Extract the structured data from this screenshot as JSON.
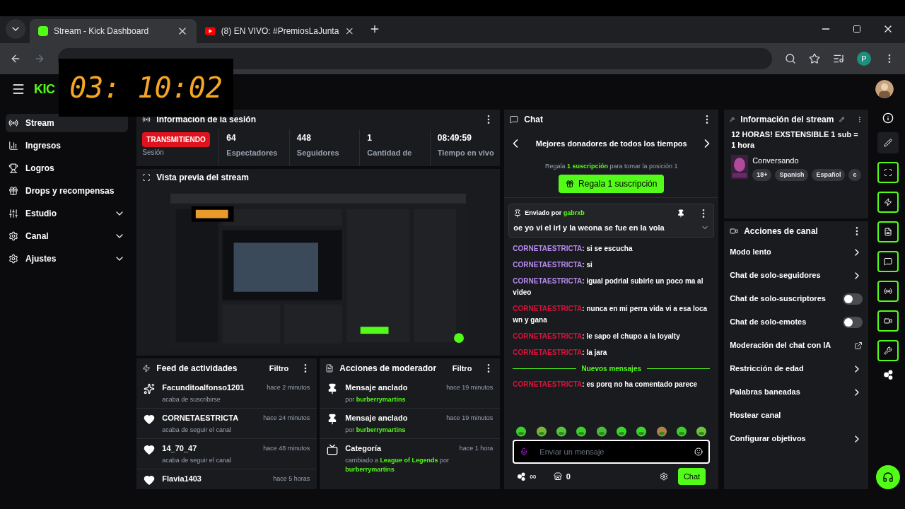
{
  "browser": {
    "tabs": [
      {
        "title": "Stream - Kick Dashboard",
        "selected": true,
        "kind": "kick"
      },
      {
        "title": "(8) EN VIVO: #PremiosLaJunta",
        "selected": false,
        "kind": "youtube"
      }
    ],
    "profile": "P"
  },
  "timer": "03: 10:02",
  "header": {
    "logo": "KIC"
  },
  "sidebar": {
    "items": [
      {
        "label": "Stream",
        "selected": true,
        "submenu": false
      },
      {
        "label": "Ingresos",
        "selected": false,
        "submenu": false
      },
      {
        "label": "Logros",
        "selected": false,
        "submenu": false
      },
      {
        "label": "Drops y recompensas",
        "selected": false,
        "submenu": false
      },
      {
        "label": "Estudio",
        "selected": false,
        "submenu": true
      },
      {
        "label": "Canal",
        "selected": false,
        "submenu": true
      },
      {
        "label": "Ajustes",
        "selected": false,
        "submenu": true
      }
    ]
  },
  "session": {
    "title": "Información de la sesión",
    "status": "TRANSMITIENDO",
    "status_label": "Sesión",
    "stats": [
      {
        "value": "64",
        "label": "Espectadores"
      },
      {
        "value": "448",
        "label": "Seguidores"
      },
      {
        "value": "1",
        "label": "Cantidad de"
      },
      {
        "value": "08:49:59",
        "label": "Tiempo en vivo"
      }
    ]
  },
  "preview": {
    "title": "Vista previa del stream",
    "kind": "picture"
  },
  "activity": {
    "title": "Feed de actividades",
    "filter": "Filtro",
    "items": [
      {
        "kind": "subscribe",
        "name": "Facunditoalfonso1201",
        "desc": "acaba de suscribirse",
        "time": "hace 2 minutos"
      },
      {
        "kind": "follow",
        "name": "CORNETAESTRICTA",
        "desc": "acaba de seguir el canal",
        "time": "hace 24 minutos"
      },
      {
        "kind": "follow",
        "name": "14_70_47",
        "desc": "acaba de seguir el canal",
        "time": "hace 48 minutos"
      },
      {
        "kind": "follow",
        "name": "Flavia1403",
        "time": "hace 5 horas"
      }
    ]
  },
  "moderator": {
    "title": "Acciones de moderador",
    "filter": "Filtro",
    "items": [
      {
        "kind": "pin",
        "name": "Mensaje anclado",
        "time": "hace 19 minutos",
        "desc": [
          {
            "text": "por ",
            "highlight": false
          },
          {
            "text": "burberrymartins",
            "highlight": true
          }
        ]
      },
      {
        "kind": "pin",
        "name": "Mensaje anclado",
        "time": "hace 19 minutos",
        "desc": [
          {
            "text": "por ",
            "highlight": false
          },
          {
            "text": "burberrymartins",
            "highlight": true
          }
        ]
      },
      {
        "kind": "category",
        "name": "Categoría",
        "time": "hace 1 hora",
        "desc": [
          {
            "text": "cambiado a ",
            "highlight": false
          },
          {
            "text": "League of Legends",
            "highlight": true
          },
          {
            "text": " por ",
            "highlight": false
          },
          {
            "text": "burberrymartins",
            "highlight": true
          }
        ]
      }
    ]
  },
  "chat": {
    "title": "Chat",
    "leaderboard": "Mejores donadores de todos los tiempos",
    "gift_line": [
      {
        "text": "Regala ",
        "highlight": false
      },
      {
        "text": "1 suscripción",
        "highlight": true
      },
      {
        "text": " para tomar la posición 1",
        "highlight": false
      }
    ],
    "gift_button": "Regala 1 suscripción",
    "pinned": {
      "by": [
        {
          "text": "Enviado por ",
          "highlight": false
        },
        {
          "text": "gabrxb",
          "highlight": true
        }
      ],
      "text": "oe yo vi el irl y la weona se fue en la vola"
    },
    "messages": [
      {
        "kind": "message",
        "user": "CORNETAESTRICTA",
        "color": "#b98af2",
        "sep": ":",
        "text": "si se escucha"
      },
      {
        "kind": "message",
        "user": "CORNETAESTRICTA",
        "color": "#b98af2",
        "sep": ":",
        "text": "si"
      },
      {
        "kind": "message",
        "user": "CORNETAESTRICTA",
        "color": "#b98af2",
        "sep": ":",
        "text": "igual podrial subirle un poco ma al video"
      },
      {
        "kind": "message",
        "user": "CORNETAESTRICTA",
        "color": "#d8143c",
        "sep": ":",
        "text": "nunca en mi perra vida vi a esa loca wn y gana"
      },
      {
        "kind": "message",
        "user": "CORNETAESTRICTA",
        "color": "#d8143c",
        "sep": ":",
        "text": "le sapo el chupo a la loyalty"
      },
      {
        "kind": "message",
        "user": "CORNETAESTRICTA",
        "color": "#d8143c",
        "sep": ":",
        "text": "la jara"
      },
      {
        "kind": "divider",
        "text": "Nuevos mensajes"
      },
      {
        "kind": "message",
        "user": "CORNETAESTRICTA",
        "color": "#d8143c",
        "sep": ":",
        "text": "es porq no ha comentado parece"
      }
    ],
    "input_placeholder": "Enviar un mensaje",
    "points": "∞",
    "count": "0",
    "send": "Chat"
  },
  "stream_info": {
    "title": "Información del stream",
    "stream_title": "12 HORAS! EXSTENSIBLE 1 sub = 1 hora",
    "category": "Conversando",
    "tags": [
      "18+",
      "Spanish",
      "Español",
      "c"
    ]
  },
  "channel_actions": {
    "title": "Acciones de canal",
    "items": [
      {
        "label": "Modo lento",
        "kind": "arrow"
      },
      {
        "label": "Chat de solo-seguidores",
        "kind": "arrow"
      },
      {
        "label": "Chat de solo-suscriptores",
        "kind": "toggle",
        "on": false
      },
      {
        "label": "Chat de solo-emotes",
        "kind": "toggle",
        "on": false
      },
      {
        "label": "Moderación del chat con IA",
        "kind": "external"
      },
      {
        "label": "Restricción de edad",
        "kind": "arrow"
      },
      {
        "label": "Palabras baneadas",
        "kind": "arrow"
      },
      {
        "label": "Hostear canal",
        "kind": "plain"
      },
      {
        "label": "Configurar objetivos",
        "kind": "arrow"
      }
    ]
  }
}
